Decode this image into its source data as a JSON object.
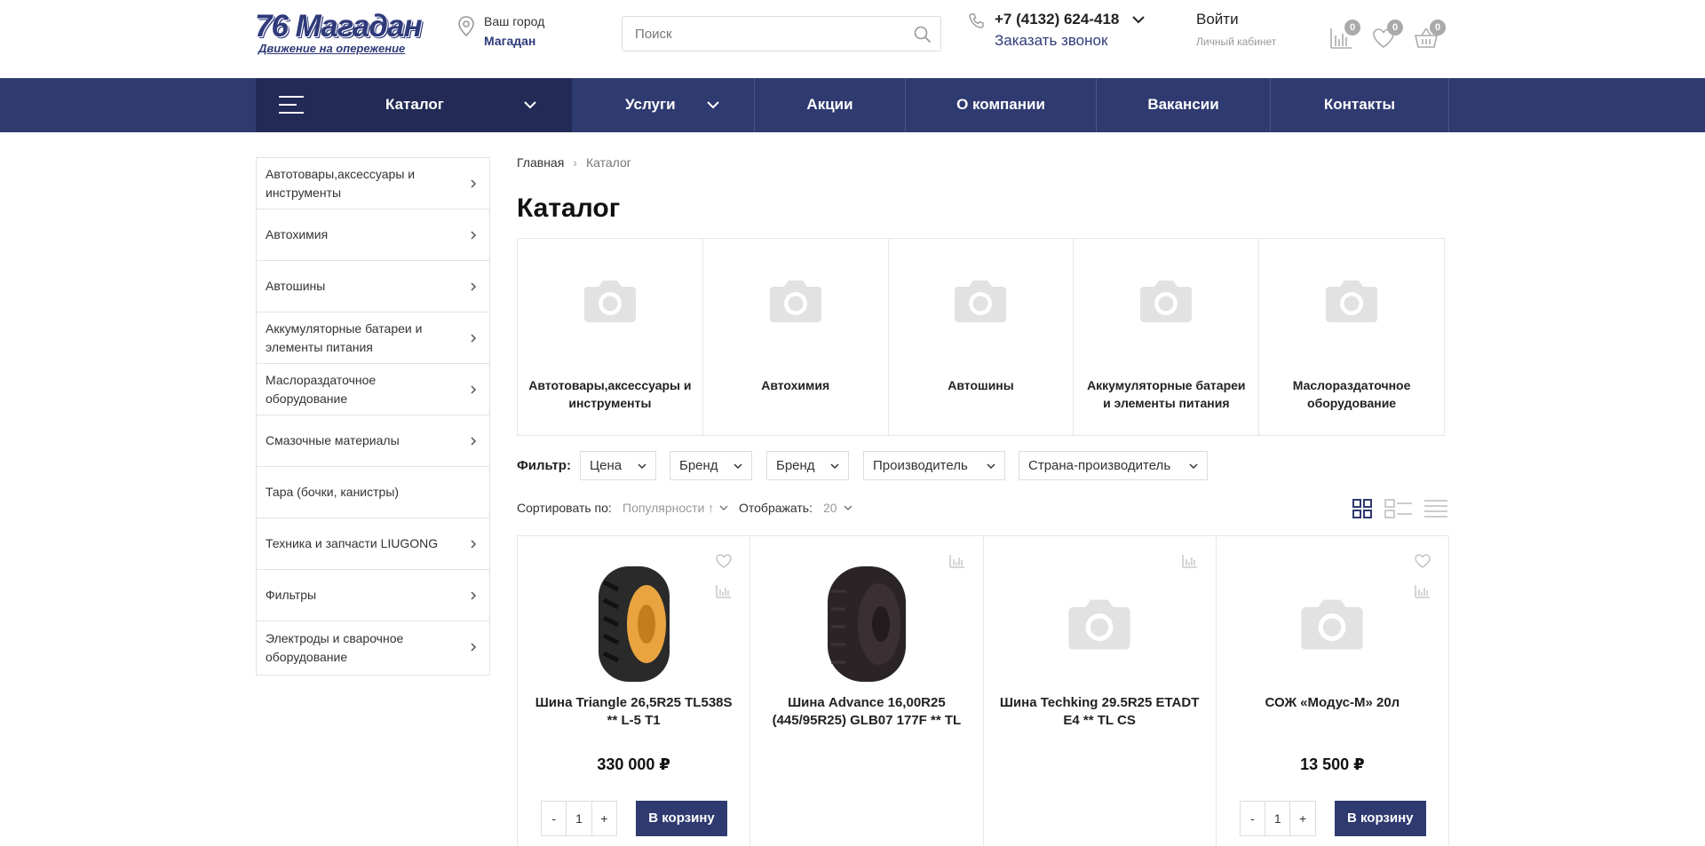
{
  "header": {
    "logo_main": "76 Магадан",
    "logo_sub": "Движение на опережение",
    "city_label": "Ваш город",
    "city_value": "Магадан",
    "search_placeholder": "Поиск",
    "phone": "+7 (4132) 624-418",
    "call_back": "Заказать звонок",
    "login": "Войти",
    "cabinet": "Личный кабинет",
    "compare_count": "0",
    "favorites_count": "0",
    "cart_count": "0"
  },
  "nav": {
    "catalog": "Каталог",
    "items": [
      "Услуги",
      "Акции",
      "О компании",
      "Вакансии",
      "Контакты"
    ]
  },
  "sidebar": {
    "items": [
      "Автотовары,аксессуары и инструменты",
      "Автохимия",
      "Автошины",
      "Аккумуляторные батареи и элементы питания",
      "Маслораздаточное оборудование",
      "Смазочные материалы",
      "Тара (бочки, канистры)",
      "Техника и запчасти LIUGONG",
      "Фильтры",
      "Электроды и сварочное оборудование"
    ]
  },
  "breadcrumb": {
    "home": "Главная",
    "separator": "›",
    "current": "Каталог"
  },
  "page_title": "Каталог",
  "categories": [
    "Автотовары,аксессуары и инструменты",
    "Автохимия",
    "Автошины",
    "Аккумуляторные батареи и элементы питания",
    "Маслораздаточное оборудование"
  ],
  "filter": {
    "label": "Фильтр:",
    "options": [
      "Цена",
      "Бренд",
      "Бренд",
      "Производитель",
      "Страна-производитель"
    ]
  },
  "sort": {
    "label": "Сортировать по:",
    "value": "Популярности ↑",
    "show_label": "Отображать:",
    "show_value": "20"
  },
  "products": [
    {
      "title": "Шина Triangle 26,5R25 TL538S ** L-5 T1",
      "price": "330 000 ₽",
      "qty": "1",
      "buy": "В корзину",
      "minus": "-",
      "plus": "+"
    },
    {
      "title": "Шина Advance 16,00R25 (445/95R25) GLB07 177F ** TL",
      "price": "",
      "qty": "",
      "buy": "",
      "minus": "",
      "plus": ""
    },
    {
      "title": "Шина Techking 29.5R25 ETADT E4 ** TL CS",
      "price": "",
      "qty": "",
      "buy": "",
      "minus": "",
      "plus": ""
    },
    {
      "title": "СОЖ «Модус-М» 20л",
      "price": "13 500 ₽",
      "qty": "1",
      "buy": "В корзину",
      "minus": "-",
      "plus": "+"
    }
  ],
  "colors": {
    "brand": "#2f3a70",
    "nav_dark": "#222a55",
    "placeholder": "#e2e2e2"
  }
}
